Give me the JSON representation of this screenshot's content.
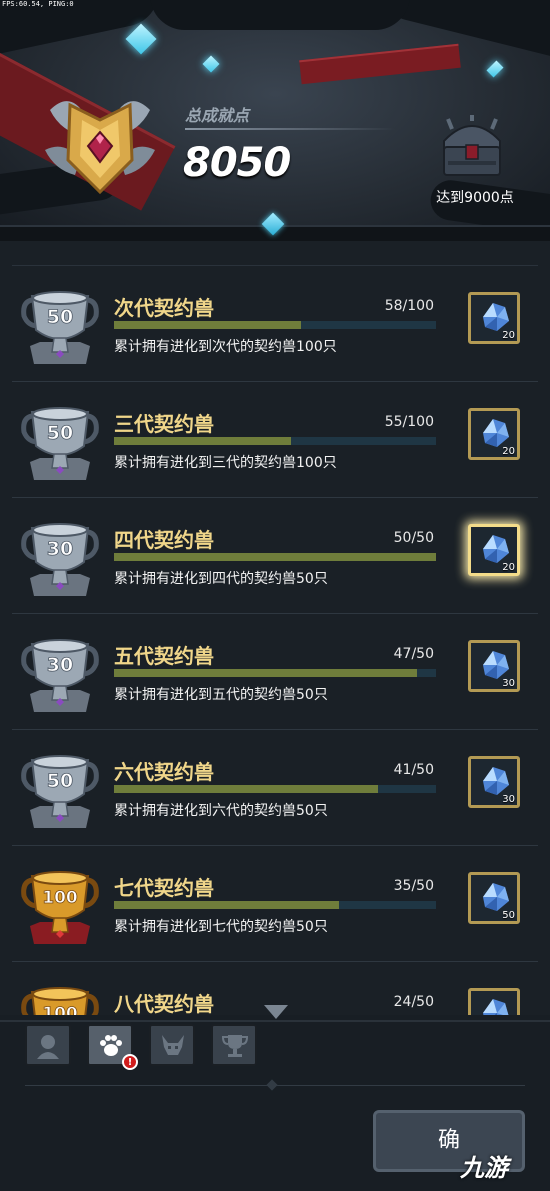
{
  "status_bar": {
    "fps_text": "FPS:60.54, PING:0"
  },
  "header": {
    "total_label": "总成就点",
    "total_score": "8050",
    "goal_text": "达到9000点"
  },
  "achievements": [
    {
      "title": "次代契约兽",
      "progress": "58/100",
      "fraction": 0.58,
      "desc": "累计拥有进化到次代的契约兽100只",
      "cup_value": "50",
      "cup_type": "silver",
      "reward_count": "20",
      "reward_ready": false
    },
    {
      "title": "三代契约兽",
      "progress": "55/100",
      "fraction": 0.55,
      "desc": "累计拥有进化到三代的契约兽100只",
      "cup_value": "50",
      "cup_type": "silver",
      "reward_count": "20",
      "reward_ready": false
    },
    {
      "title": "四代契约兽",
      "progress": "50/50",
      "fraction": 1.0,
      "desc": "累计拥有进化到四代的契约兽50只",
      "cup_value": "30",
      "cup_type": "silver",
      "reward_count": "20",
      "reward_ready": true
    },
    {
      "title": "五代契约兽",
      "progress": "47/50",
      "fraction": 0.94,
      "desc": "累计拥有进化到五代的契约兽50只",
      "cup_value": "30",
      "cup_type": "silver",
      "reward_count": "30",
      "reward_ready": false
    },
    {
      "title": "六代契约兽",
      "progress": "41/50",
      "fraction": 0.82,
      "desc": "累计拥有进化到六代的契约兽50只",
      "cup_value": "50",
      "cup_type": "silver",
      "reward_count": "30",
      "reward_ready": false
    },
    {
      "title": "七代契约兽",
      "progress": "35/50",
      "fraction": 0.7,
      "desc": "累计拥有进化到七代的契约兽50只",
      "cup_value": "100",
      "cup_type": "gold",
      "reward_count": "50",
      "reward_ready": false
    },
    {
      "title": "八代契约兽",
      "progress": "24/50",
      "fraction": 0.48,
      "desc": "",
      "cup_value": "100",
      "cup_type": "gold",
      "reward_count": "",
      "reward_ready": false
    }
  ],
  "tabs": [
    {
      "name": "hero-tab",
      "icon": "hero-bust-icon",
      "active": false
    },
    {
      "name": "beast-tab",
      "icon": "paw-icon",
      "active": true,
      "alert": "!"
    },
    {
      "name": "demon-tab",
      "icon": "demon-mask-icon",
      "active": false
    },
    {
      "name": "trophy-tab",
      "icon": "trophy-icon",
      "active": false
    }
  ],
  "action_button": {
    "label": "确"
  },
  "watermark": {
    "text": "九游"
  },
  "colors": {
    "title_gold": "#f0d68a",
    "bar_fill": "#6f7d3b",
    "bar_track": "#1f3644",
    "reward_border": "#b39a54",
    "alert_red": "#d01d1d"
  }
}
